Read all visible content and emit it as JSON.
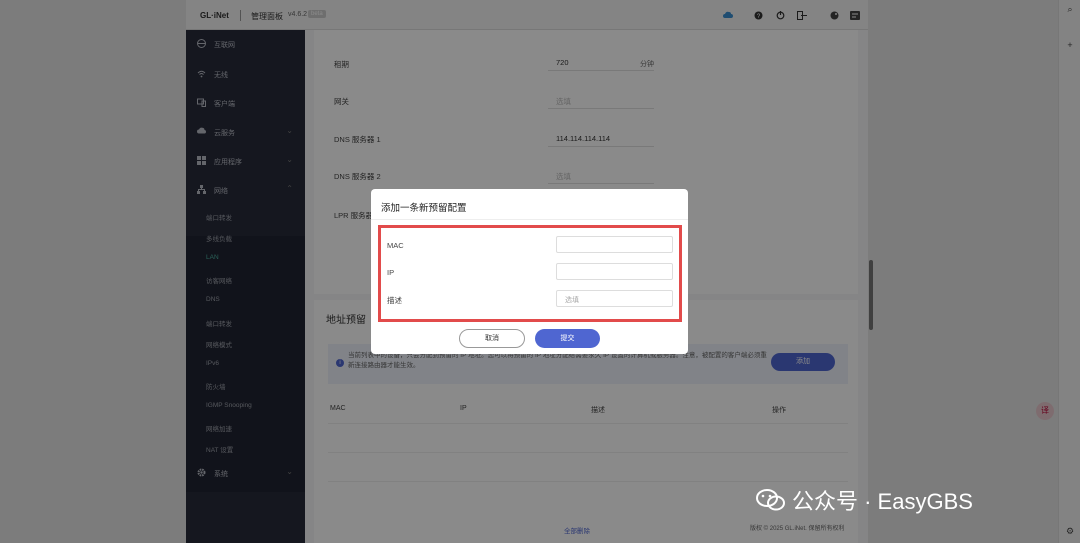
{
  "topbar": {
    "logo": "GL·iNet",
    "panel_title": "管理面板",
    "version": "v4.6.2",
    "beta": "beta"
  },
  "sidebar": {
    "items": [
      {
        "label": "互联网",
        "icon": "globe-icon"
      },
      {
        "label": "无线",
        "icon": "wifi-icon"
      },
      {
        "label": "客户端",
        "icon": "clients-icon"
      },
      {
        "label": "云服务",
        "icon": "cloud-icon"
      },
      {
        "label": "应用程序",
        "icon": "apps-icon"
      },
      {
        "label": "网络",
        "icon": "network-icon"
      },
      {
        "label": "系统",
        "icon": "gear-icon"
      }
    ],
    "network_sub": [
      "端口转发",
      "多线负载",
      "IPv6",
      "防火墙",
      "DNS",
      "网络模式",
      "LAN",
      "IPv6",
      "访客网络",
      "IGMP Snooping",
      "网络加速",
      "NAT 设置"
    ]
  },
  "card1": {
    "fields": [
      {
        "label": "租期",
        "value": "720",
        "unit": "分钟"
      },
      {
        "label": "网关",
        "value": "选填"
      },
      {
        "label": "DNS 服务器 1",
        "value": "114.114.114.114"
      },
      {
        "label": "DNS 服务器 2",
        "value": "选填"
      },
      {
        "label": "LPR 服务器",
        "value": ""
      }
    ]
  },
  "card2": {
    "title": "地址预留",
    "info_text": "当前列表中的设备，只会分配到预留的 IP 地址。您可以将预留的 IP 地址分配给需要永久 IP 设置的计算机或服务器。注意，被配置的客户端必须重新连接路由器才能生效。",
    "add_label": "添加",
    "columns": [
      "MAC",
      "IP",
      "描述",
      "操作"
    ],
    "delete_all": "全部删除"
  },
  "footer": "版权 © 2025 GL.iNet. 保留所有权利",
  "dialog": {
    "title": "添加一条新预留配置",
    "fields": [
      {
        "label": "MAC",
        "placeholder": ""
      },
      {
        "label": "IP",
        "placeholder": ""
      },
      {
        "label": "描述",
        "placeholder": "选填"
      }
    ],
    "cancel": "取消",
    "submit": "提交"
  },
  "watermark": {
    "text": "公众号 · EasyGBS"
  },
  "translate_badge": "译"
}
